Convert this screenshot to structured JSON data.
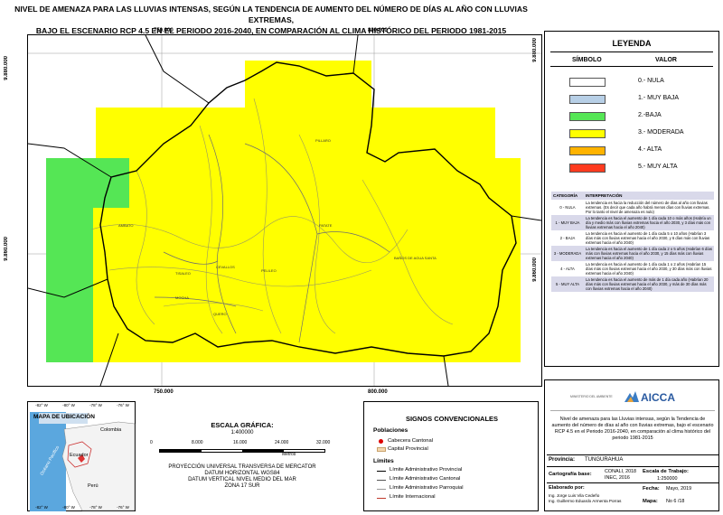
{
  "title": {
    "line1": "NIVEL DE AMENAZA PARA LAS LLUVIAS INTENSAS, SEGÚN LA TENDENCIA DE AUMENTO DEL NÚMERO DE DÍAS AL AÑO CON LLUVIAS EXTREMAS,",
    "line2": "BAJO EL ESCENARIO RCP 4.5 EN EL PERIODO 2016-2040, EN COMPARACIÓN AL CLIMA HISTÓRICO DEL PERIODO 1981-2015"
  },
  "map": {
    "coords": {
      "top_left": "750.000",
      "top_right": "800.000",
      "bottom_left": "750.000",
      "bottom_right": "800.000",
      "left_top": "9.880.000",
      "left_bottom": "9.860.000",
      "right_top": "9.880.000",
      "right_bottom": "9.860.000"
    },
    "places": {
      "pillaro": "PILLARO",
      "ambato": "AMBATO",
      "patate": "PATATE",
      "banos": "BAÑOS DE AGUA SANTA",
      "tisaleo": "TISALEO",
      "cevallos": "CEVALLOS",
      "pelileo": "PELILEO",
      "mocha": "MOCHA",
      "quero": "QUERO"
    },
    "colors": {
      "moderada": "#ffff00",
      "baja": "#55e655",
      "boundary": "#000000"
    }
  },
  "legend": {
    "title": "LEYENDA",
    "col_symbol": "SÍMBOLO",
    "col_value": "VALOR",
    "items": [
      {
        "label": "0.- NULA",
        "color": "#ffffff"
      },
      {
        "label": "1.- MUY BAJA",
        "color": "#b7cfe6"
      },
      {
        "label": "2.-BAJA",
        "color": "#55e655"
      },
      {
        "label": "3.- MODERADA",
        "color": "#ffff00"
      },
      {
        "label": "4.- ALTA",
        "color": "#ffb300"
      },
      {
        "label": "5.- MUY ALTA",
        "color": "#ff3b1f"
      }
    ],
    "interp_head_cat": "CATEGORÍA",
    "interp_head_text": "INTERPRETACIÓN",
    "interp": [
      {
        "cat": "0 - NULA",
        "text": "La tendencia es hacia la reducción del número de días al año con lluvias extremas. (Es decir que cada año habrá menos días con lluvias extremas. Por lo tanto el nivel de amenaza es nulo)"
      },
      {
        "cat": "1 - MUY BAJA",
        "text": "La tendencia es hacia el aumento de 1 día cada 10 o más años (Habría un día y medio más con lluvias extremas hacia el año 2030, y 3 días más con lluvias extremas hacia el año 2040)"
      },
      {
        "cat": "2 - BAJA",
        "text": "La tendencia es hacia el aumento de 1 día cada 5 o 10 años (Habrían 3 días más con lluvias extremas hacia el año 2030, y 6 días más con lluvias extremas hacia el año 2040)"
      },
      {
        "cat": "3 - MODERADA",
        "text": "La tendencia es hacia el aumento de 1 día cada 2 o 5 años (Habrían 6 días más con lluvias extremas hacia el año 2030, y 15 días más con lluvias extremas hacia el año 2040)"
      },
      {
        "cat": "4 - ALTA",
        "text": "La tendencia es hacia el aumento de 1 día cada 1 o 2 años (Habrían 15 días más con lluvias extremas hacia el año 2030, y 30 días más con lluvias extremas hacia el año 2040)"
      },
      {
        "cat": "5 - MUY ALTA",
        "text": "La tendencia es hacia el aumento de más de 1 día cada año (Habrían 20 días más con lluvias extremas hacia el año 2030, y más de 30 días más con lluvias extremas hacia el año 2040)"
      }
    ]
  },
  "location_map": {
    "title": "MAPA DE UBICACIÓN",
    "top_ticks": [
      "-82° W",
      "-80° W",
      "-78° W",
      "-76° W"
    ],
    "bottom_ticks": [
      "-82° W",
      "-80° W",
      "-78° W",
      "-76° W"
    ],
    "countries": {
      "colombia": "Colombia",
      "ecuador": "Ecuador",
      "peru": "Perú"
    },
    "ocean": "Océano Pacífico"
  },
  "scale": {
    "title": "ESCALA GRÁFICA:",
    "ratio": "1:400000",
    "ticks": [
      "0",
      "8.000",
      "16.000",
      "24.000",
      "32.000"
    ],
    "unit": "Metros",
    "projection": [
      "PROYECCIÓN UNIVERSAL TRANSVERSA DE MERCATOR",
      "DATUM HORIZONTAL WGS84",
      "DATUM VERTICAL NIVEL MEDIO DEL MAR",
      "ZONA 17 SUR"
    ]
  },
  "signs": {
    "title": "SIGNOS CONVENCIONALES",
    "populations": "Poblaciones",
    "cabecera_cantonal": "Cabecera Cantonal",
    "capital_provincial": "Capital Provincial",
    "limits": "Límites",
    "limit_items": [
      "Límite Administrativo Provincial",
      "Límite Administrativo Cantonal",
      "Límite Administrativo Parroquial",
      "Límite Internacional"
    ]
  },
  "info": {
    "logo_text": "AICCA",
    "org1": "MINISTERIO DEL AMBIENTE",
    "description": "Nivel de amenaza para las Lluvias intensas, según la Tendencia de aumento del número de días al año con lluvias extremas, bajo el escenario RCP 4.5 en el Periodo 2016-2040, en comparación al clima histórico del periodo 1981-2015",
    "province_label": "Provincia:",
    "province_value": "TUNGURAHUA",
    "base_label": "Cartografía base:",
    "base_value1": "CONALI, 2018",
    "base_value2": "INEC, 2016",
    "work_scale_label": "Escala de Trabajo:",
    "work_scale_value": "1:250000",
    "made_by_label": "Elaborado por:",
    "author1": "Ing. Jorge Luis Vila Cedeño",
    "author2": "Ing. Guillermo Eduardo Armenta Porras",
    "date_label": "Fecha:",
    "date_value": "Mayo, 2019",
    "map_label": "Mapa:",
    "map_value": "No 6 /18"
  }
}
